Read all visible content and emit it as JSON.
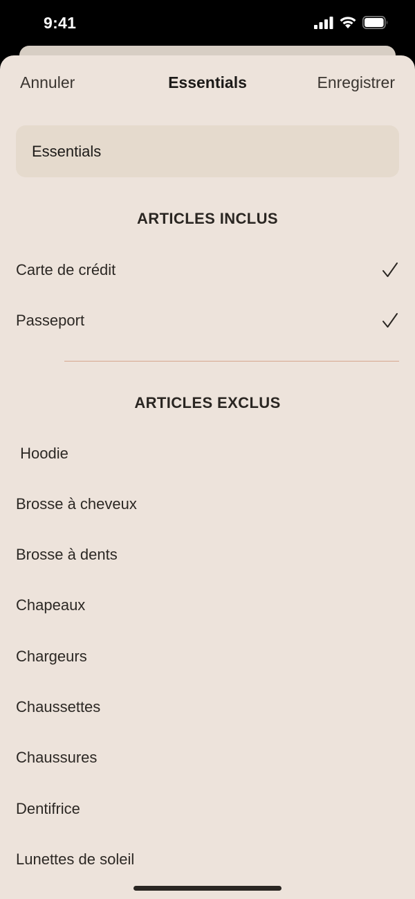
{
  "status_bar": {
    "time": "9:41"
  },
  "nav": {
    "cancel_label": "Annuler",
    "title": "Essentials",
    "save_label": "Enregistrer"
  },
  "name_field": {
    "value": "Essentials"
  },
  "included": {
    "header": "ARTICLES INCLUS",
    "items": [
      {
        "label": "Carte de crédit",
        "checked": true
      },
      {
        "label": "Passeport",
        "checked": true
      }
    ]
  },
  "excluded": {
    "header": "ARTICLES EXCLUS",
    "items": [
      {
        "label": " Hoodie"
      },
      {
        "label": "Brosse à cheveux"
      },
      {
        "label": "Brosse à dents"
      },
      {
        "label": "Chapeaux"
      },
      {
        "label": "Chargeurs"
      },
      {
        "label": "Chaussettes"
      },
      {
        "label": "Chaussures"
      },
      {
        "label": "Dentifrice"
      },
      {
        "label": "Lunettes de soleil"
      }
    ]
  },
  "colors": {
    "sheet_background": "#ede3db",
    "field_background": "#e5dacd",
    "divider": "#d6a68e"
  }
}
